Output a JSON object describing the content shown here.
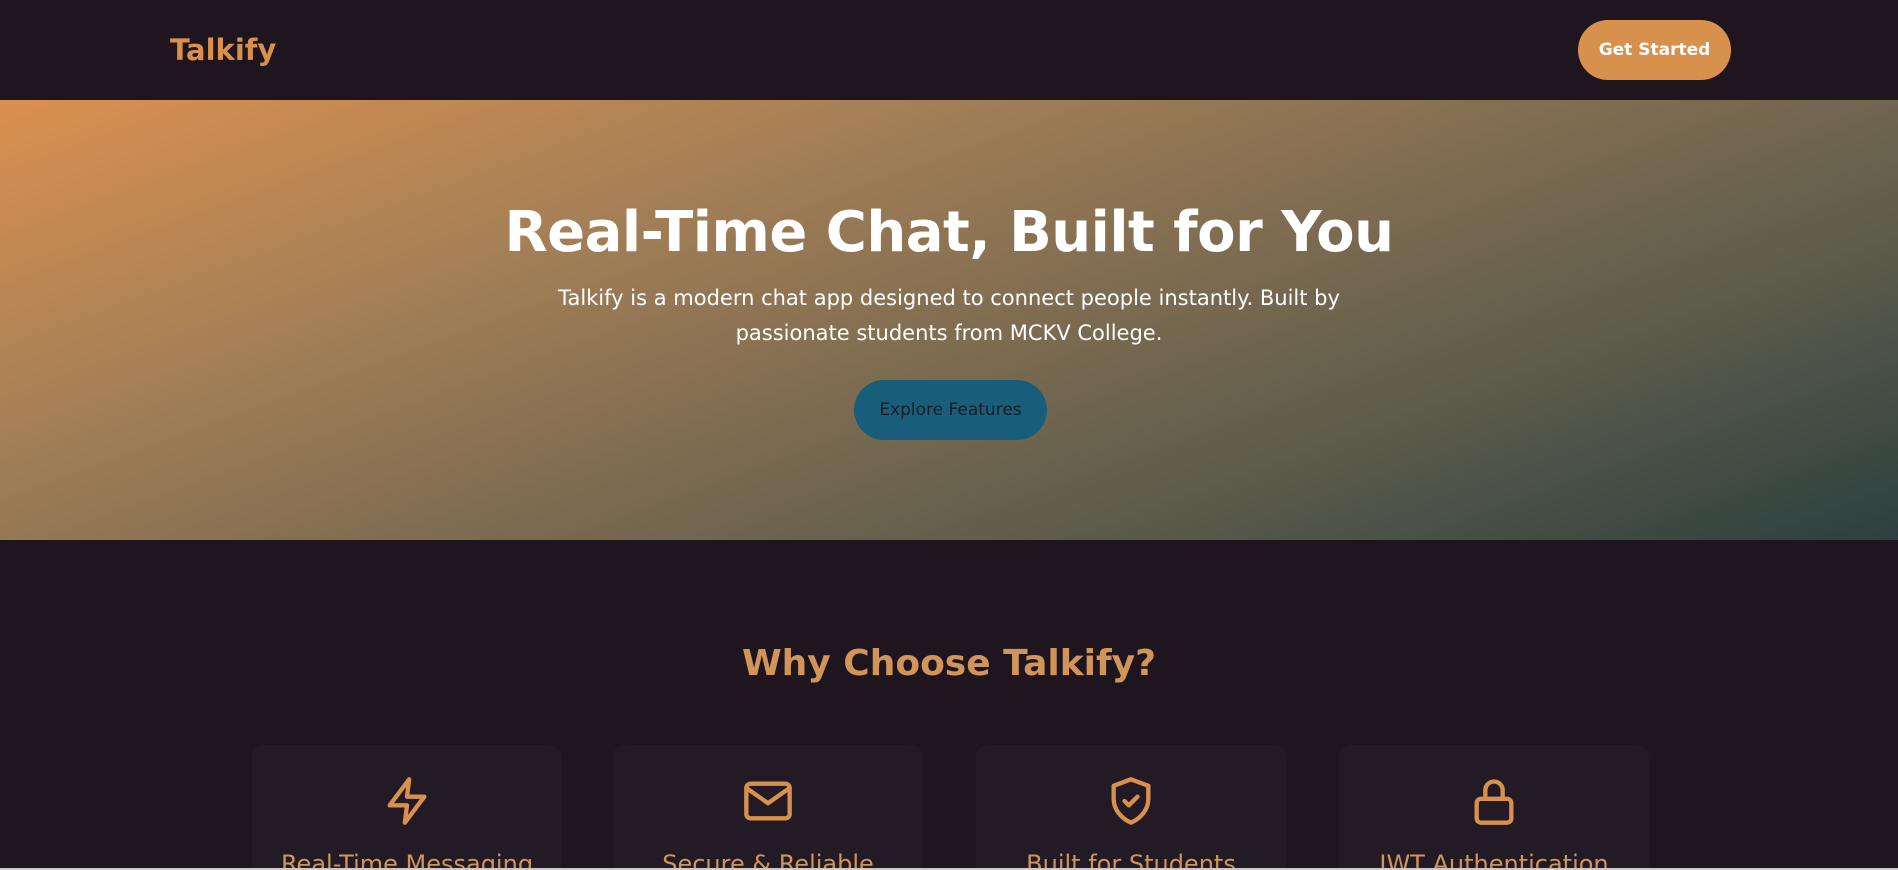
{
  "header": {
    "logo": "Talkify",
    "cta_label": "Get Started"
  },
  "hero": {
    "title": "Real-Time Chat, Built for You",
    "subtitle": "Talkify is a modern chat app designed to connect people instantly. Built by passionate students from MCKV College.",
    "cta_label": "Explore Features"
  },
  "features": {
    "title": "Why Choose Talkify?",
    "cards": [
      {
        "title": "Real-Time Messaging",
        "icon": "lightning-icon"
      },
      {
        "title": "Secure & Reliable",
        "icon": "mail-icon"
      },
      {
        "title": "Built for Students",
        "icon": "shield-check-icon"
      },
      {
        "title": "JWT Authentication",
        "icon": "lock-icon"
      }
    ]
  },
  "colors": {
    "accent": "#d8914d",
    "background": "#1e151f",
    "explore_button": "#185e7a"
  }
}
